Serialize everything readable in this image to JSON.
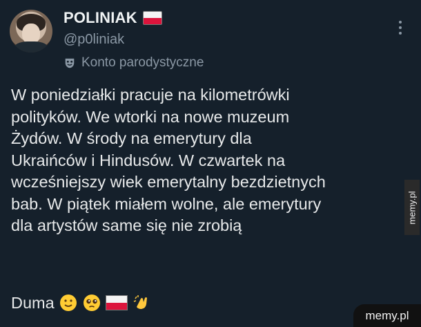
{
  "author": {
    "display_name": "POLINIAK",
    "handle": "@p0liniak",
    "label": "Konto parodystyczne",
    "avatar_icon": "profile-photo",
    "flag_icon": "poland-flag"
  },
  "tweet": {
    "text": "W poniedziałki pracuje na kilometrówki\npolityków. We wtorki na nowe muzeum\nŻydów. W środy na emerytury dla\nUkraińców i Hindusów. W czwartek na\nwcześniejszy wiek emerytalny bezdzietnych\nbab. W piątek miałem wolne, ale emerytury\ndla artystów same się nie zrobią",
    "footer_text": "Duma",
    "footer_emojis": [
      "slightly-smiling-face",
      "pleading-face",
      "poland-flag",
      "clapping-hands"
    ]
  },
  "watermarks": {
    "side": "memy.pl",
    "bottom": "memy.pl"
  },
  "colors": {
    "background": "#15202b",
    "text": "#e7e9ea",
    "muted": "#8b98a5",
    "flag_red": "#dc143c"
  }
}
